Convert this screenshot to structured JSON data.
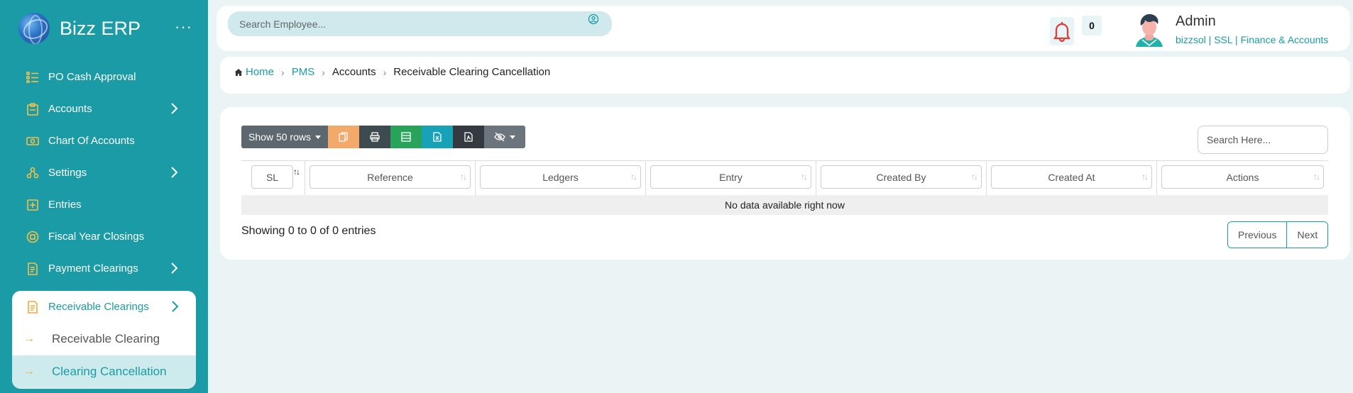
{
  "app": {
    "brand": "Bizz ERP",
    "more": "···"
  },
  "sidebar": {
    "items": [
      {
        "label": "PO Cash Approval",
        "icon": "list-icon",
        "chevron": false
      },
      {
        "label": "Accounts",
        "icon": "clipboard-icon",
        "chevron": true
      },
      {
        "label": "Chart Of Accounts",
        "icon": "money-icon",
        "chevron": false
      },
      {
        "label": "Settings",
        "icon": "nodes-icon",
        "chevron": true
      },
      {
        "label": "Entries",
        "icon": "plus-square-icon",
        "chevron": false
      },
      {
        "label": "Fiscal Year Closings",
        "icon": "circle-square-icon",
        "chevron": false
      },
      {
        "label": "Payment Clearings",
        "icon": "receipt-icon",
        "chevron": true
      }
    ],
    "open_group": {
      "label": "Receivable Clearings",
      "icon": "receipt-icon",
      "children": [
        {
          "label": "Receivable Clearing",
          "active": false
        },
        {
          "label": "Clearing Cancellation",
          "active": true
        }
      ]
    }
  },
  "topbar": {
    "search_placeholder": "Search Employee...",
    "notification_count": "0",
    "user_name": "Admin",
    "user_sub": "bizzsol | SSL  | Finance & Accounts"
  },
  "breadcrumb": {
    "home": "Home",
    "items": [
      "PMS",
      "Accounts",
      "Receivable Clearing Cancellation"
    ]
  },
  "table": {
    "show_rows": "Show 50 rows",
    "search_placeholder": "Search Here...",
    "columns": [
      "SL",
      "Reference",
      "Ledgers",
      "Entry",
      "Created By",
      "Created At",
      "Actions"
    ],
    "empty_message": "No data available right now",
    "info": "Showing 0 to 0 of 0 entries",
    "prev": "Previous",
    "next": "Next"
  },
  "colors": {
    "primary": "#1a9ba5",
    "accent": "#f3c14a",
    "bell": "#e53935"
  }
}
